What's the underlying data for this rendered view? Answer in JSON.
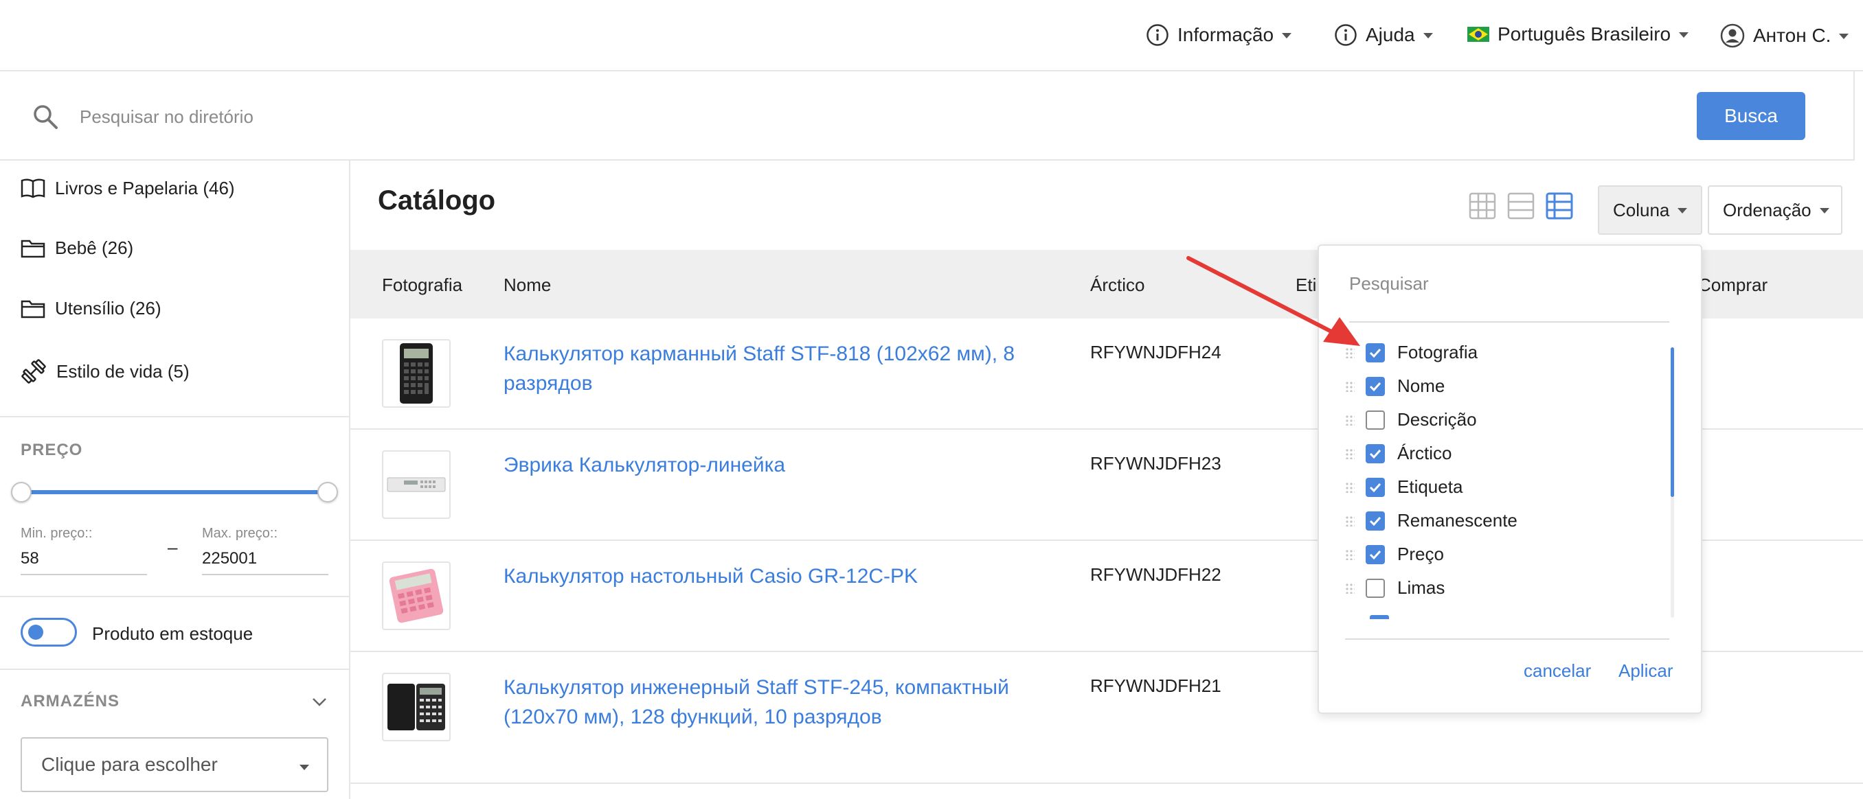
{
  "topnav": {
    "info": "Informação",
    "help": "Ajuda",
    "language": "Português Brasileiro",
    "user": "Антон С."
  },
  "search": {
    "placeholder": "Pesquisar no diretório",
    "button": "Busca"
  },
  "sidebar": {
    "categories": [
      {
        "label": "Livros e Papelaria (46)",
        "icon": "book-icon"
      },
      {
        "label": "Bebê (26)",
        "icon": "folder-icon"
      },
      {
        "label": "Utensílio (26)",
        "icon": "folder-icon"
      },
      {
        "label": "Estilo de vida (5)",
        "icon": "dumbbell-icon"
      }
    ],
    "price": {
      "title": "PREÇO",
      "min_label": "Min. preço::",
      "max_label": "Max. preço::",
      "min_value": "58",
      "max_value": "225001",
      "separator": "–"
    },
    "in_stock_label": "Produto em estoque",
    "warehouses": {
      "title": "ARMAZÉNS",
      "select_placeholder": "Clique para escolher"
    }
  },
  "main": {
    "title": "Catálogo",
    "column_button": "Coluna",
    "sort_button": "Ordenação",
    "columns": [
      "Fotografia",
      "Nome",
      "Árctico",
      "Eti",
      "Comprar"
    ],
    "products": [
      {
        "name": "Калькулятор карманный Staff STF-818 (102х62 мм), 8 разрядов",
        "sku": "RFYWNJDFH24"
      },
      {
        "name": "Эврика Калькулятор-линейка",
        "sku": "RFYWNJDFH23"
      },
      {
        "name": "Калькулятор настольный Casio GR-12C-PK",
        "sku": "RFYWNJDFH22"
      },
      {
        "name": "Калькулятор инженерный Staff STF-245, компактный (120х70 мм), 128 функций, 10 разрядов",
        "sku": "RFYWNJDFH21"
      }
    ]
  },
  "column_dropdown": {
    "search_placeholder": "Pesquisar",
    "items": [
      {
        "label": "Fotografia",
        "checked": true
      },
      {
        "label": "Nome",
        "checked": true
      },
      {
        "label": "Descrição",
        "checked": false
      },
      {
        "label": "Árctico",
        "checked": true
      },
      {
        "label": "Etiqueta",
        "checked": true
      },
      {
        "label": "Remanescente",
        "checked": true
      },
      {
        "label": "Preço",
        "checked": true
      },
      {
        "label": "Limas",
        "checked": false
      }
    ],
    "cancel": "cancelar",
    "apply": "Aplicar"
  },
  "colors": {
    "accent": "#4a86dc",
    "link": "#3b7ddd",
    "annotation_arrow": "#e53935"
  }
}
